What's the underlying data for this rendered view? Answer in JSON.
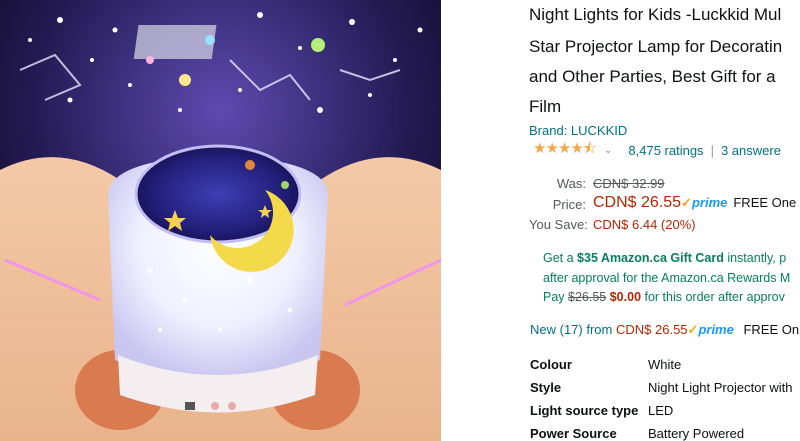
{
  "product": {
    "title_lines": [
      "Night Lights for Kids -Luckkid Mul",
      "Star Projector Lamp for Decoratin",
      "and Other Parties, Best Gift for a",
      "Film"
    ],
    "brand": "Brand: LUCKKID",
    "rating_stars": "★★★★⯪",
    "rating_value_shown": 4.5,
    "ratings_count": "8,475 ratings",
    "answers": "3 answere"
  },
  "price": {
    "was_label": "Was:",
    "was_value": "CDN$ 32.99",
    "price_label": "Price:",
    "price_value": "CDN$ 26.55",
    "prime_label": "prime",
    "free_text": "FREE One",
    "save_label": "You Save:",
    "save_value": "CDN$ 6.44 (20%)"
  },
  "gift_offer": {
    "l1_prefix": "Get a ",
    "l1_bold": "$35 Amazon.ca Gift Card",
    "l1_suffix": " instantly, p",
    "l2": "after approval for the Amazon.ca Rewards M",
    "l3_prefix": "Pay ",
    "l3_old": "$26.55",
    "l3_new": "$0.00",
    "l3_suffix": " for this order after approv"
  },
  "new_offers": {
    "link": "New (17) from",
    "price": "CDN$ 26.55",
    "prime_label": "prime",
    "free_text": "FREE On"
  },
  "specs": [
    {
      "key": "Colour",
      "value": "White"
    },
    {
      "key": "Style",
      "value": "Night Light Projector with"
    },
    {
      "key": "Light source type",
      "value": "LED"
    },
    {
      "key": "Power Source",
      "value": "Battery Powered"
    }
  ],
  "colors": {
    "link": "#007185",
    "price_red": "#b12704",
    "gift_green": "#067d62",
    "star_gold": "#f3a847",
    "prime_blue": "#1a98ff"
  }
}
